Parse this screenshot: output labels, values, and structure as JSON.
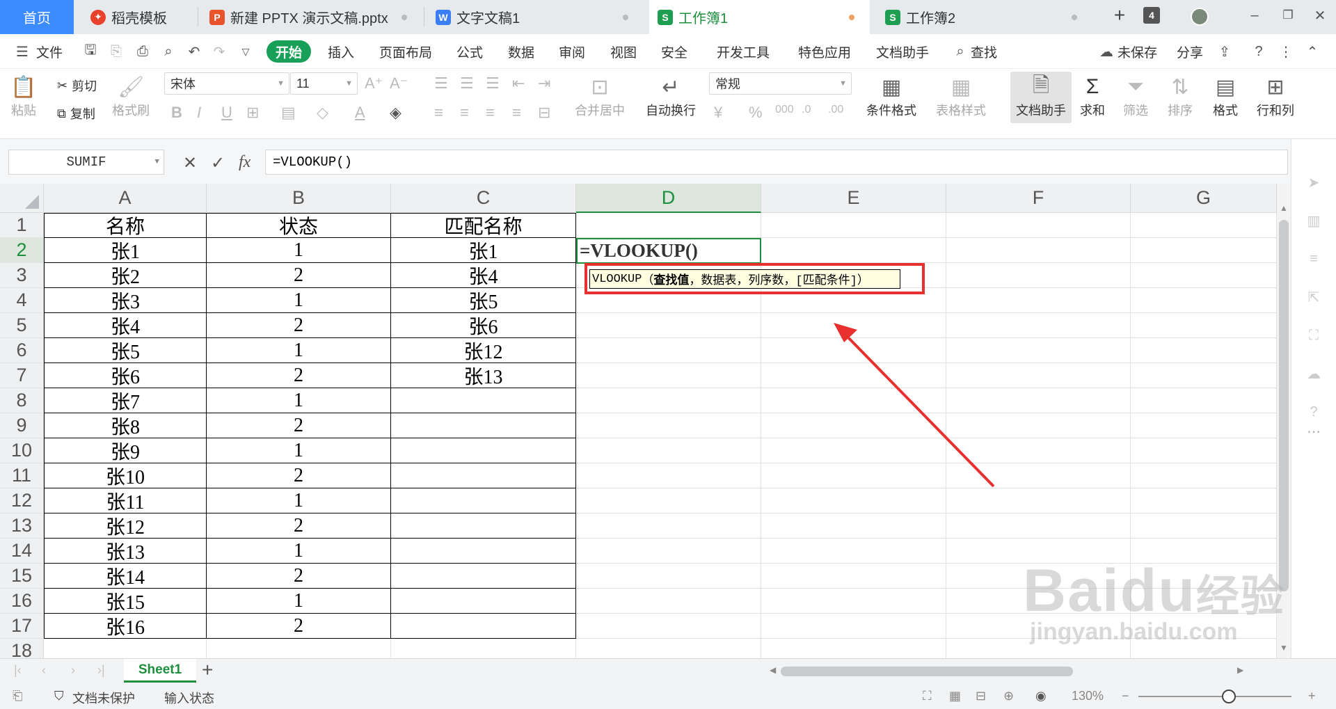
{
  "tabs": [
    {
      "label": "首页"
    },
    {
      "label": "稻壳模板"
    },
    {
      "label": "新建 PPTX 演示文稿.pptx"
    },
    {
      "label": "文字文稿1"
    },
    {
      "label": "工作簿1"
    },
    {
      "label": "工作簿2"
    }
  ],
  "tab_count": "4",
  "menu": {
    "file": "文件",
    "start": "开始",
    "insert": "插入",
    "page_layout": "页面布局",
    "formula": "公式",
    "data": "数据",
    "review": "审阅",
    "view": "视图",
    "security": "安全",
    "dev_tools": "开发工具",
    "special": "特色应用",
    "doc_assistant": "文档助手",
    "search": "查找",
    "unsaved": "未保存",
    "share": "分享"
  },
  "ribbon": {
    "paste": "粘贴",
    "cut": "剪切",
    "copy": "复制",
    "format_painter": "格式刷",
    "font_name": "宋体",
    "font_size": "11",
    "merge": "合并居中",
    "wrap": "自动换行",
    "number_format": "常规",
    "cond_format": "条件格式",
    "table_style": "表格样式",
    "doc_assistant": "文档助手",
    "sum": "求和",
    "filter": "筛选",
    "sort": "排序",
    "format": "格式",
    "row_col": "行和列"
  },
  "formula_bar": {
    "name_box": "SUMIF",
    "formula": "=VLOOKUP()",
    "fx": "fx"
  },
  "columns": [
    "A",
    "B",
    "C",
    "D",
    "E",
    "F",
    "G"
  ],
  "rows": [
    "1",
    "2",
    "3",
    "4",
    "5",
    "6",
    "7",
    "8",
    "9",
    "10",
    "11",
    "12",
    "13",
    "14",
    "15",
    "16",
    "17",
    "18"
  ],
  "table": {
    "headers": [
      "名称",
      "状态",
      "匹配名称"
    ],
    "col_a": [
      "张1",
      "张2",
      "张3",
      "张4",
      "张5",
      "张6",
      "张7",
      "张8",
      "张9",
      "张10",
      "张11",
      "张12",
      "张13",
      "张14",
      "张15",
      "张16"
    ],
    "col_b": [
      "1",
      "2",
      "1",
      "2",
      "1",
      "2",
      "1",
      "2",
      "1",
      "2",
      "1",
      "2",
      "1",
      "2",
      "1",
      "2"
    ],
    "col_c": [
      "张1",
      "张4",
      "张5",
      "张6",
      "张12",
      "张13"
    ]
  },
  "active_cell": {
    "ref": "D2",
    "value": "=VLOOKUP()"
  },
  "tooltip": {
    "fn": "VLOOKUP",
    "open": "（",
    "arg1": "查找值",
    "sep1": "，",
    "arg2": "数据表",
    "sep2": "，",
    "arg3": "列序数",
    "sep3": "，",
    "arg4": "[匹配条件]",
    "close": "）"
  },
  "annotation_color": "#e8302e",
  "sheet_tab": "Sheet1",
  "status": {
    "protect": "文档未保护",
    "mode": "输入状态",
    "zoom": "130%"
  },
  "watermark": {
    "brand": "Baidu",
    "product": "经验",
    "url": "jingyan.baidu.com"
  }
}
